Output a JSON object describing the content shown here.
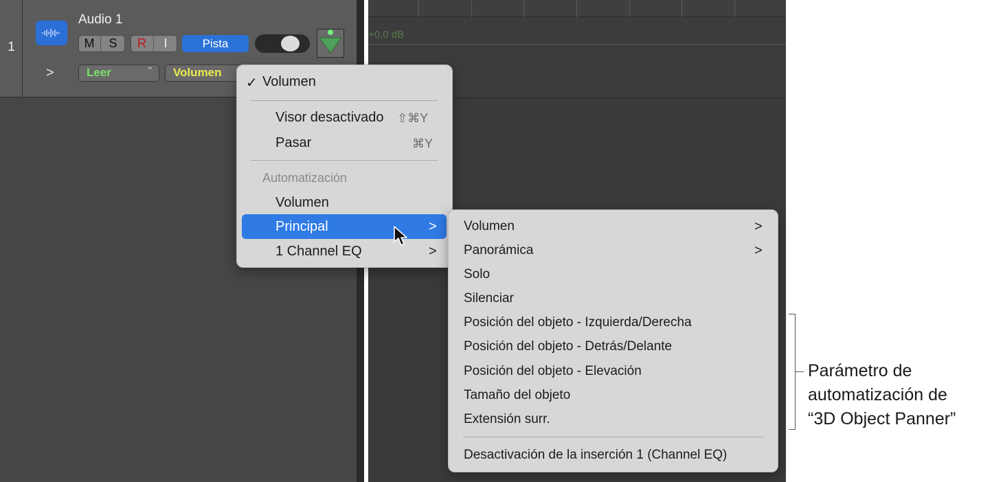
{
  "track": {
    "number": "1",
    "name": "Audio 1",
    "buttons": {
      "mute": "M",
      "solo": "S",
      "record": "R",
      "input": "I",
      "track": "Pista"
    },
    "automation_mode": "Leer",
    "automation_param": "Volumen",
    "icon": "waveform-icon"
  },
  "arrange": {
    "automation_value": "+0,0 dB"
  },
  "main_menu": {
    "checked_item": "Volumen",
    "checkmark": "✓",
    "visor": {
      "label": "Visor desactivado",
      "shortcut": "⇧⌘Y"
    },
    "pasar": {
      "label": "Pasar",
      "shortcut": "⌘Y"
    },
    "section_header": "Automatización",
    "items": [
      "Volumen",
      "Principal",
      "1 Channel EQ"
    ],
    "chevron": ">"
  },
  "sub_menu": {
    "items": [
      "Volumen",
      "Panorámica",
      "Solo",
      "Silenciar",
      "Posición del objeto - Izquierda/Derecha",
      "Posición del objeto - Detrás/Delante",
      "Posición del objeto - Elevación",
      "Tamaño del objeto",
      "Extensión surr."
    ],
    "bottom_item": "Desactivación de la inserción 1 (Channel EQ)",
    "chevron": ">"
  },
  "callout": {
    "line1": "Parámetro de",
    "line2": "automatización de",
    "line3": "“3D Object Panner”"
  },
  "colors": {
    "highlight": "#2f7ae4",
    "track_icon": "#2c6fd6",
    "read_green": "#7be16b",
    "param_yellow": "#ecec52",
    "record_red": "#c0161a"
  }
}
